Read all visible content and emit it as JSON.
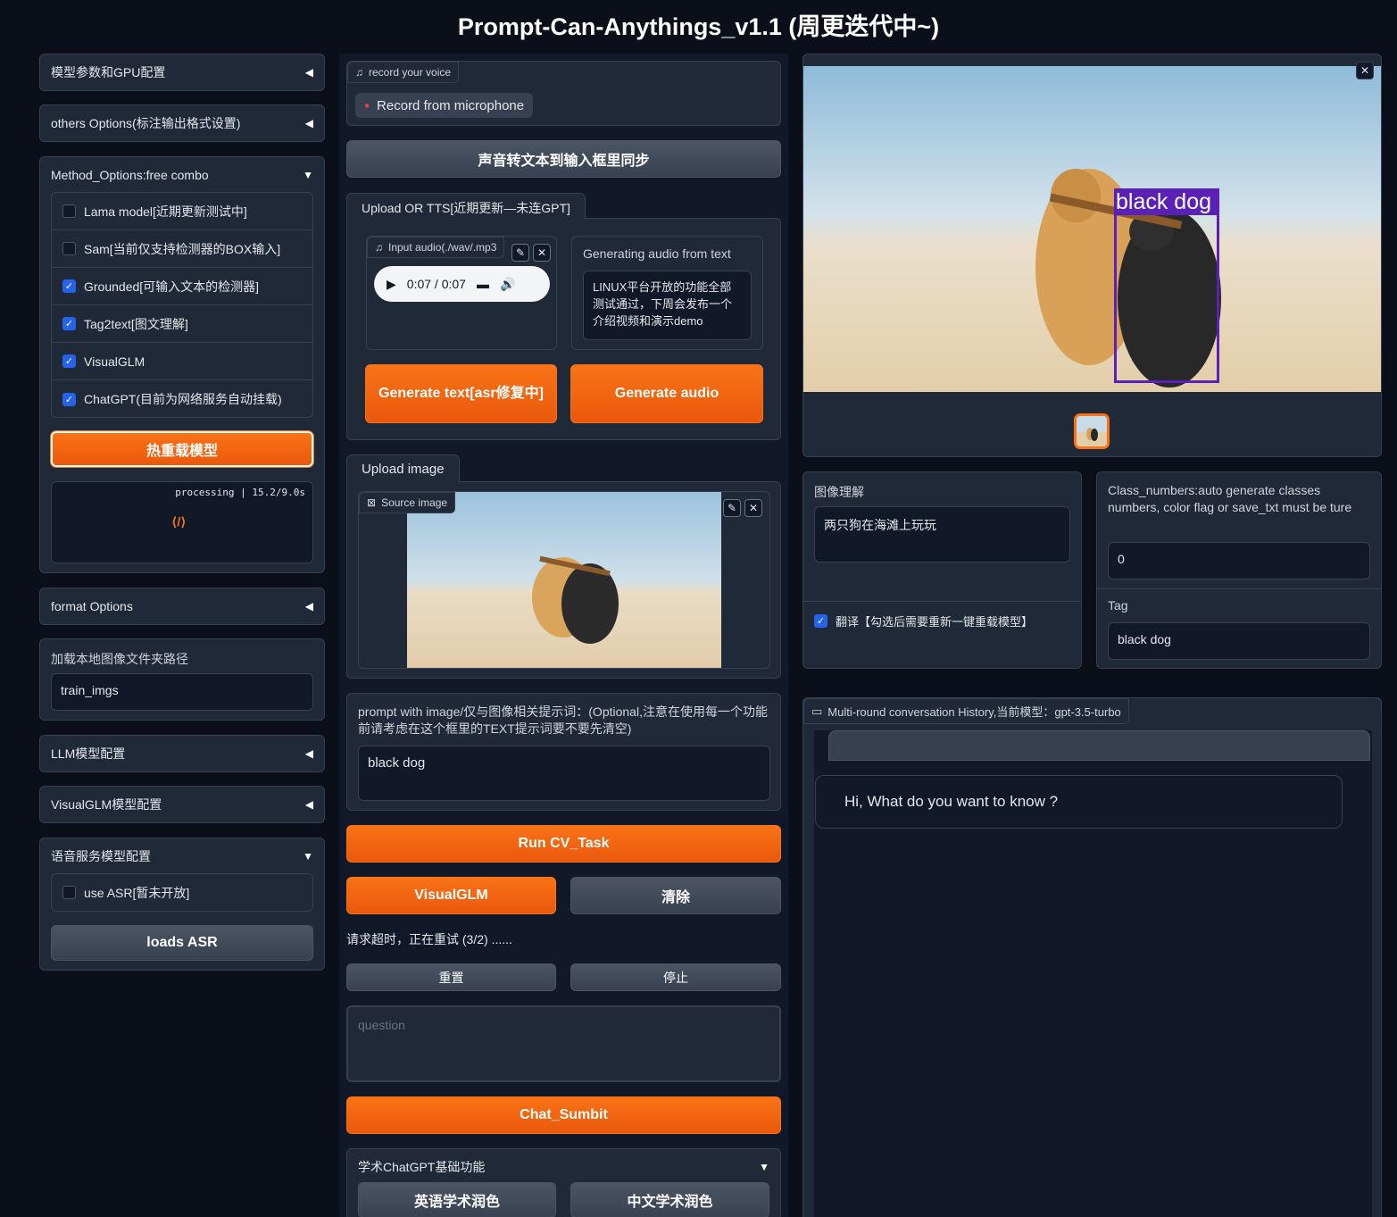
{
  "app": {
    "title": "Prompt-Can-Anythings_v1.1 (周更迭代中~)"
  },
  "left": {
    "model_gpu": "模型参数和GPU配置",
    "others_options": "others Options(标注输出格式设置)",
    "method_options": "Method_Options:free combo",
    "methods": [
      {
        "label": "Lama model[近期更新测试中]",
        "checked": false
      },
      {
        "label": "Sam[当前仅支持检测器的BOX输入]",
        "checked": false
      },
      {
        "label": "Grounded[可输入文本的检测器]",
        "checked": true
      },
      {
        "label": "Tag2text[图文理解]",
        "checked": true
      },
      {
        "label": "VisualGLM",
        "checked": true
      },
      {
        "label": "ChatGPT(目前为网络服务自动挂载)",
        "checked": true
      }
    ],
    "reload_button": "热重载模型",
    "processing_text": "processing | 15.2/9.0s",
    "format_options": "format Options",
    "local_folder_label": "加载本地图像文件夹路径",
    "local_folder_value": "train_imgs",
    "llm_config": "LLM模型配置",
    "visualglm_config": "VisualGLM模型配置",
    "speech_config": "语音服务模型配置",
    "use_asr_label": "use ASR[暂未开放]",
    "use_asr_checked": false,
    "loads_asr": "loads ASR"
  },
  "middle": {
    "record_label": "record your voice",
    "record_button": "Record from microphone",
    "sync_button": "声音转文本到输入框里同步",
    "upload_tts_tab": "Upload OR TTS[近期更新—未连GPT]",
    "input_audio_label": "Input audio(./wav/.mp3",
    "audio_time": "0:07 / 0:07",
    "gen_audio_label": "Generating audio from text",
    "gen_audio_text": "LINUX平台开放的功能全部测试通过，下周会发布一个介绍视频和演示demo",
    "gen_text_button": "Generate text[asr修复中]",
    "gen_audio_button": "Generate audio",
    "upload_image_tab": "Upload image",
    "source_image_label": "Source image",
    "prompt_label": "prompt with image/仅与图像相关提示词：(Optional,注意在使用每一个功能前请考虑在这个框里的TEXT提示词要不要先清空)",
    "prompt_value": "black dog",
    "run_cv": "Run CV_Task",
    "visualglm_button": "VisualGLM",
    "clear_button": "清除",
    "retry_status": "请求超时，正在重试 (3/2) ......",
    "reset_button": "重置",
    "stop_button": "停止",
    "question_placeholder": "question",
    "chat_submit": "Chat_Sumbit",
    "academic_label": "学术ChatGPT基础功能",
    "english_polish": "英语学术润色",
    "chinese_polish": "中文学术润色"
  },
  "right": {
    "detection_label": "black dog",
    "image_understanding_label": "图像理解",
    "image_understanding_value": "两只狗在海滩上玩玩",
    "translate_label": "翻译【勾选后需要重新一键重载模型】",
    "translate_checked": true,
    "class_numbers_label": "Class_numbers:auto generate classes numbers, color flag or save_txt must be ture",
    "class_numbers_value": "0",
    "tag_label": "Tag",
    "tag_value": "black dog",
    "history_label": "Multi-round conversation History,当前模型：gpt-3.5-turbo",
    "bot_message": "Hi, What do you want to know ?"
  },
  "colors": {
    "accent": "#f97316",
    "bg": "#0b0f19",
    "panel": "#1f2937",
    "check": "#2563eb",
    "bbox": "#5b21b6"
  }
}
